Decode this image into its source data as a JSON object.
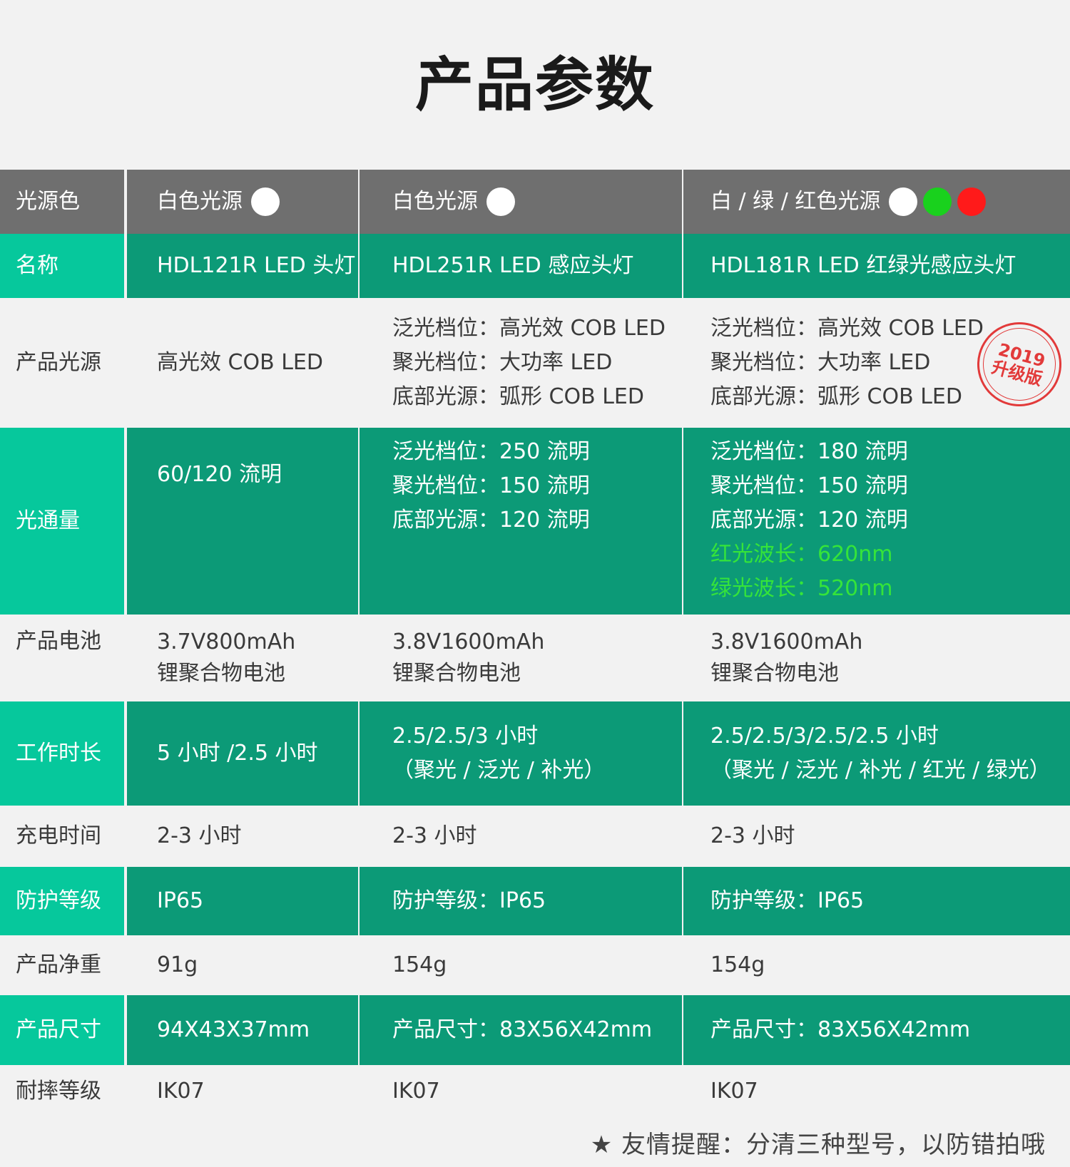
{
  "title": "产品参数",
  "colors": {
    "header_gray": "#6f6f6f",
    "label_green": "#06c89c",
    "row_green": "#0c9a77",
    "stamp_red": "#e23a3a",
    "wavelength_green": "#35e43a",
    "dot_white": "#ffffff",
    "dot_green": "#19d11d",
    "dot_red": "#ff1a1a"
  },
  "header": {
    "label": "光源色",
    "col1": "白色光源",
    "col2": "白色光源",
    "col3": "白 / 绿 / 红色光源",
    "dots": {
      "col1": [
        "white"
      ],
      "col2": [
        "white"
      ],
      "col3": [
        "white",
        "green",
        "red"
      ]
    }
  },
  "rows": {
    "name": {
      "label": "名称",
      "col1": "HDL121R  LED 头灯",
      "col2": "HDL251R  LED 感应头灯",
      "col3": "HDL181R  LED 红绿光感应头灯"
    },
    "source": {
      "label": "产品光源",
      "col1": "高光效 COB LED",
      "col2": [
        "泛光档位：高光效 COB LED",
        "聚光档位：大功率 LED",
        "底部光源：弧形 COB LED"
      ],
      "col3": [
        "泛光档位：高光效 COB LED",
        "聚光档位：大功率 LED",
        "底部光源：弧形 COB LED"
      ]
    },
    "lumen": {
      "label": "光通量",
      "col1": "60/120 流明",
      "col2": [
        "泛光档位：250 流明",
        "聚光档位：150 流明",
        "底部光源：120 流明"
      ],
      "col3": [
        "泛光档位：180 流明",
        "聚光档位：150 流明",
        "底部光源：120 流明",
        "红光波长：620nm",
        "绿光波长：520nm"
      ]
    },
    "battery": {
      "label": "产品电池",
      "col1": [
        "3.7V800mAh",
        "锂聚合物电池"
      ],
      "col2": [
        "3.8V1600mAh",
        "锂聚合物电池"
      ],
      "col3": [
        "3.8V1600mAh",
        "锂聚合物电池"
      ]
    },
    "runtime": {
      "label": "工作时长",
      "col1": "5 小时 /2.5 小时",
      "col2": [
        "2.5/2.5/3 小时",
        "（聚光 / 泛光 / 补光）"
      ],
      "col3": [
        "2.5/2.5/3/2.5/2.5 小时",
        "（聚光 / 泛光 / 补光 / 红光 / 绿光）"
      ]
    },
    "charge": {
      "label": "充电时间",
      "col1": "2-3 小时",
      "col2": "2-3 小时",
      "col3": "2-3 小时"
    },
    "ip": {
      "label": "防护等级",
      "col1": "IP65",
      "col2": "防护等级：IP65",
      "col3": "防护等级：IP65"
    },
    "weight": {
      "label": "产品净重",
      "col1": "91g",
      "col2": "154g",
      "col3": "154g"
    },
    "size": {
      "label": "产品尺寸",
      "col1": "94X43X37mm",
      "col2": "产品尺寸：83X56X42mm",
      "col3": "产品尺寸：83X56X42mm"
    },
    "drop": {
      "label": "耐摔等级",
      "col1": "IK07",
      "col2": "IK07",
      "col3": "IK07"
    }
  },
  "stamp": {
    "year": "2019",
    "text": "升级版"
  },
  "footer": "★ 友情提醒：分清三种型号，以防错拍哦"
}
